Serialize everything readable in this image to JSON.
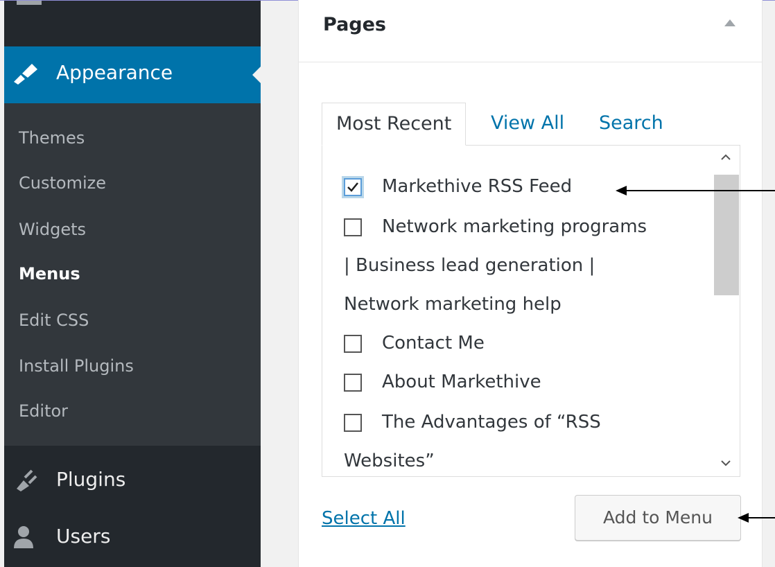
{
  "sidebar": {
    "active": {
      "label": "Appearance",
      "icon": "paintbrush-icon"
    },
    "submenu": [
      "Themes",
      "Customize",
      "Widgets",
      "Menus",
      "Edit CSS",
      "Install Plugins",
      "Editor"
    ],
    "current_submenu": "Menus",
    "items": [
      {
        "label": "Plugins",
        "icon": "plugin-icon"
      },
      {
        "label": "Users",
        "icon": "user-icon"
      }
    ]
  },
  "panel": {
    "title": "Pages",
    "tabs": [
      "Most Recent",
      "View All",
      "Search"
    ],
    "active_tab": "Most Recent",
    "entries": [
      {
        "label": "Markethive RSS Feed",
        "checked": true
      },
      {
        "label": "Network marketing programs",
        "checked": false
      },
      {
        "label": "| Business lead generation |",
        "continuation": true
      },
      {
        "label": "Network marketing help",
        "continuation": true
      },
      {
        "label": "Contact Me",
        "checked": false
      },
      {
        "label": "About Markethive",
        "checked": false
      },
      {
        "label": "The Advantages of “RSS",
        "checked": false
      },
      {
        "label": "Websites”",
        "continuation": true
      }
    ],
    "select_all_label": "Select All",
    "add_button_label": "Add to Menu"
  },
  "colors": {
    "accent": "#0073aa",
    "sidebar_bg": "#23282d",
    "submenu_bg": "#32373c"
  }
}
